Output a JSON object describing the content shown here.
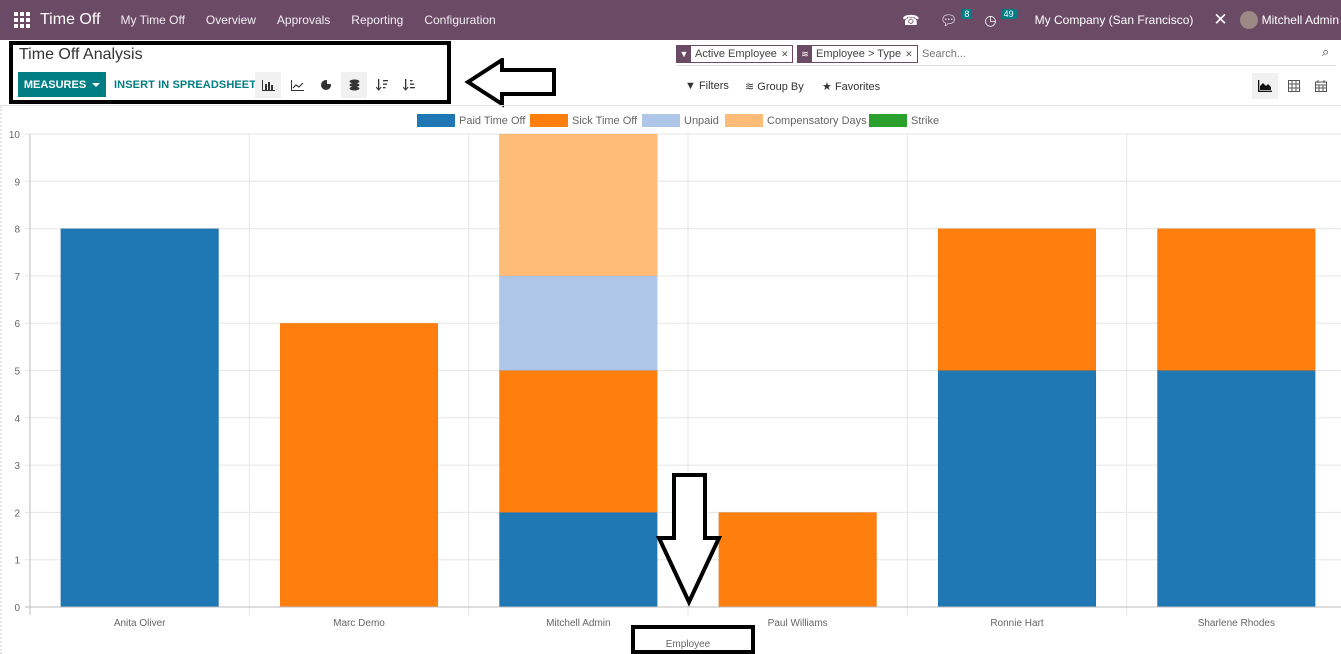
{
  "topbar": {
    "app_name": "Time Off",
    "menus": [
      "My Time Off",
      "Overview",
      "Approvals",
      "Reporting",
      "Configuration"
    ],
    "messages_count": "8",
    "activities_count": "49",
    "company": "My Company (San Francisco)",
    "user": "Mitchell Admin"
  },
  "control_panel": {
    "title": "Time Off Analysis",
    "measures_label": "MEASURES",
    "insert_label": "INSERT IN SPREADSHEET",
    "tools": [
      "bar-chart",
      "line-chart",
      "pie-chart",
      "stacked",
      "sort-descending",
      "sort-ascending"
    ]
  },
  "search": {
    "facets": [
      {
        "type": "filter",
        "label": "Active Employee"
      },
      {
        "type": "groupby",
        "label": "Employee > Type"
      }
    ],
    "placeholder": "Search...",
    "filters_label": "Filters",
    "groupby_label": "Group By",
    "favorites_label": "Favorites"
  },
  "views": [
    "graph",
    "pivot",
    "calendar"
  ],
  "colors": {
    "brand": "#6b4a66",
    "accent": "#017e84"
  },
  "chart_data": {
    "type": "bar",
    "stacked": true,
    "title": "",
    "xlabel": "Employee",
    "ylabel": "",
    "ylim": [
      0,
      10
    ],
    "yticks": [
      0,
      1,
      2,
      3,
      4,
      5,
      6,
      7,
      8,
      9,
      10
    ],
    "grid": true,
    "legend_position": "top",
    "categories": [
      "Anita Oliver",
      "Marc Demo",
      "Mitchell Admin",
      "Paul Williams",
      "Ronnie Hart",
      "Sharlene Rhodes"
    ],
    "series": [
      {
        "name": "Paid Time Off",
        "color": "#1f77b4",
        "values": [
          8,
          0,
          2,
          0,
          5,
          5
        ]
      },
      {
        "name": "Sick Time Off",
        "color": "#ff7f0e",
        "values": [
          0,
          6,
          3,
          2,
          3,
          3
        ]
      },
      {
        "name": "Unpaid",
        "color": "#aec7e8",
        "values": [
          0,
          0,
          2,
          0,
          0,
          0
        ]
      },
      {
        "name": "Compensatory Days",
        "color": "#ffbb78",
        "values": [
          0,
          0,
          3,
          0,
          0,
          0
        ]
      },
      {
        "name": "Strike",
        "color": "#2ca02c",
        "values": [
          0,
          0,
          0,
          0,
          0,
          0
        ]
      }
    ]
  }
}
